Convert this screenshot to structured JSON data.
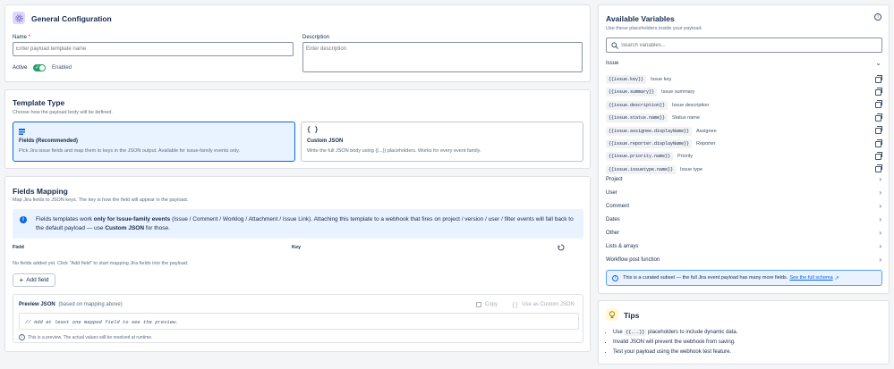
{
  "general": {
    "title": "General Configuration",
    "name_label": "Name",
    "name_required": "*",
    "name_placeholder": "Enter payload template name",
    "description_label": "Description",
    "description_placeholder": "Enter description",
    "active_label": "Active",
    "active_value": "Enabled",
    "active_on": true
  },
  "template_type": {
    "title": "Template Type",
    "subtitle": "Choose how the payload body will be defined.",
    "options": [
      {
        "label": "Fields (Recommended)",
        "desc": "Pick Jira issue fields and map them to keys in the JSON output. Available for issue-family events only.",
        "selected": true,
        "icon": "list-icon"
      },
      {
        "label": "Custom JSON",
        "desc": "Write the full JSON body using {{...}} placeholders. Works for every event family.",
        "selected": false,
        "icon": "braces-icon",
        "icon_text": "{ }"
      }
    ]
  },
  "fields_mapping": {
    "title": "Fields Mapping",
    "subtitle": "Map Jira fields to JSON keys. The key is how the field will appear in the payload.",
    "info": {
      "t1": "Fields templates work ",
      "t2": "only for Issue-family events",
      "t3": " (Issue / Comment / Worklog / Attachment / Issue Link). Attaching this template to a webhook that fires on project / version / user / filter events will fall back to the default payload — use ",
      "t4": "Custom JSON",
      "t5": " for those."
    },
    "col_field": "Field",
    "col_key": "Key",
    "empty": "No fields added yet. Click \"Add field\" to start mapping Jira fields into the payload.",
    "add_button": "Add field",
    "preview": {
      "title": "Preview JSON",
      "subtitle": "(based on mapping above)",
      "copy": "Copy",
      "use_custom": "Use as Custom JSON",
      "code": "// Add at least one mapped field to see the preview.",
      "note": "This is a preview. The actual values will be resolved at runtime."
    }
  },
  "variables": {
    "title": "Available Variables",
    "subtitle": "Use these placeholders inside your payload.",
    "search_placeholder": "Search variables...",
    "issue_group": "Issue",
    "items": [
      {
        "code": "{{issue.key}}",
        "label": "Issue key"
      },
      {
        "code": "{{issue.summary}}",
        "label": "Issue summary"
      },
      {
        "code": "{{issue.description}}",
        "label": "Issue description"
      },
      {
        "code": "{{issue.status.name}}",
        "label": "Status name"
      },
      {
        "code": "{{issue.assignee.displayName}}",
        "label": "Assignee"
      },
      {
        "code": "{{issue.reporter.displayName}}",
        "label": "Reporter"
      },
      {
        "code": "{{issue.priority.name}}",
        "label": "Priority"
      },
      {
        "code": "{{issue.issuetype.name}}",
        "label": "Issue type"
      }
    ],
    "groups": [
      "Project",
      "User",
      "Comment",
      "Dates",
      "Other",
      "Lists & arrays",
      "Workflow post function"
    ],
    "note": "This is a curated subset — the full Jira event payload has many more fields. ",
    "note_link": "See the full schema"
  },
  "tips": {
    "title": "Tips",
    "items": [
      {
        "pre": "Use ",
        "code": "{{...}}",
        "post": " placeholders to include dynamic data."
      },
      {
        "pre": "Invalid JSON will prevent the webhook from saving.",
        "code": "",
        "post": ""
      },
      {
        "pre": "Test your payload using the webhook test feature.",
        "code": "",
        "post": ""
      }
    ]
  },
  "colors": {
    "accent": "#0c66e4",
    "selected_bg": "#e9f2ff",
    "info_bg": "#e9f2ff",
    "toggle_on": "#22a06b",
    "tips_icon_bg": "#fff7d6"
  }
}
